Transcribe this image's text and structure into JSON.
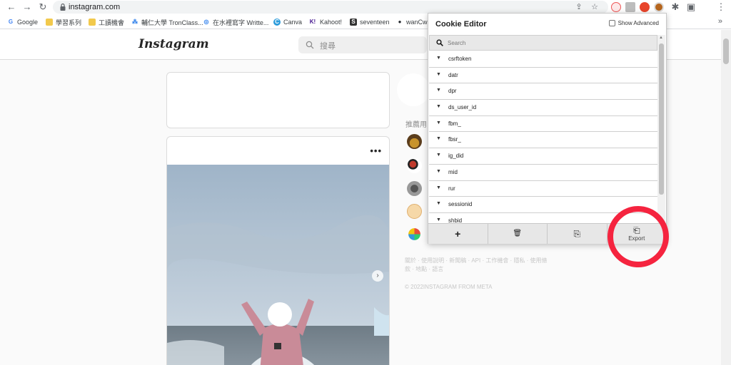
{
  "browser": {
    "url": "instagram.com",
    "bookmarks": [
      {
        "label": "Google",
        "color": "#4285f4",
        "glyph": "G"
      },
      {
        "label": "學習系列",
        "color": "#f2c94c",
        "glyph": ""
      },
      {
        "label": "工讀機會",
        "color": "#f2c94c",
        "glyph": ""
      },
      {
        "label": "輔仁大學 TronClass...",
        "color": "#1a73e8",
        "glyph": "⁂"
      },
      {
        "label": "在水裡寫字 Writte...",
        "color": "#2f80ed",
        "glyph": "◎"
      },
      {
        "label": "Canva",
        "color": "#2d9cdb",
        "glyph": "C"
      },
      {
        "label": "Kahoot!",
        "color": "#46178f",
        "glyph": "K!"
      },
      {
        "label": "seventeen",
        "color": "#333333",
        "glyph": "S"
      },
      {
        "label": "wanCw",
        "color": "#24292e",
        "glyph": "●"
      }
    ],
    "more_label": "»"
  },
  "instagram": {
    "logo": "Instagram",
    "search_placeholder": "搜尋",
    "suggest_title": "推薦用",
    "footer_links": "關於 · 使用說明 · 新聞稿 · API · 工作機會 · 隱私 · 使用條款 · 地點 · 語言",
    "copyright": "© 2022INSTAGRAM FROM META",
    "post_menu": "•••"
  },
  "cookie_editor": {
    "title": "Cookie Editor",
    "show_advanced_label": "Show Advanced",
    "search_placeholder": "Search",
    "cookies": [
      "csrftoken",
      "datr",
      "dpr",
      "ds_user_id",
      "fbm_",
      "fbsr_",
      "ig_did",
      "mid",
      "rur",
      "sessionid",
      "shbid"
    ],
    "toolbar": {
      "add_icon": "+",
      "delete_icon": "🗑",
      "import_icon": "⎘",
      "export_icon": "⎗",
      "export_label": "Export"
    }
  },
  "colors": {
    "highlight_circle": "#f5243f",
    "toolbar_bg": "#e7e7e7"
  }
}
